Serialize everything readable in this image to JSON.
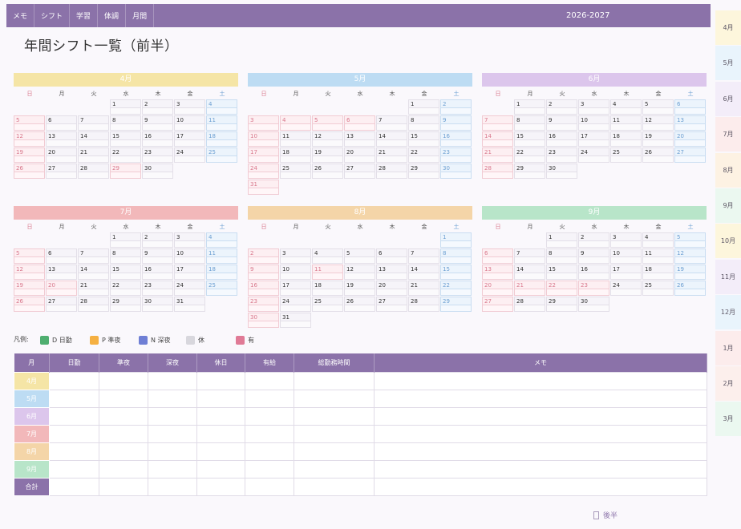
{
  "colors": {
    "accent": "#8b72a9"
  },
  "nav": {
    "tabs": [
      {
        "label": "メモ"
      },
      {
        "label": "シフト"
      },
      {
        "label": "学習"
      },
      {
        "label": "体調"
      },
      {
        "label": "月間"
      }
    ],
    "year_range": "2026-2027"
  },
  "side_tabs": [
    {
      "label": "4月",
      "color": "#fdf6dc"
    },
    {
      "label": "5月",
      "color": "#e9f4fc"
    },
    {
      "label": "6月",
      "color": "#f3edf9"
    },
    {
      "label": "7月",
      "color": "#fcecec"
    },
    {
      "label": "8月",
      "color": "#fdf2e3"
    },
    {
      "label": "9月",
      "color": "#ebf8f0"
    },
    {
      "label": "10月",
      "color": "#fdf6dc"
    },
    {
      "label": "11月",
      "color": "#f3edf9"
    },
    {
      "label": "12月",
      "color": "#e9f4fc"
    },
    {
      "label": "1月",
      "color": "#fcecec"
    },
    {
      "label": "2月",
      "color": "#fcefec"
    },
    {
      "label": "3月",
      "color": "#ebf8f0"
    }
  ],
  "title": "年間シフト一覧（前半）",
  "weekdays": [
    "日",
    "月",
    "火",
    "水",
    "木",
    "金",
    "土"
  ],
  "calendars": [
    {
      "label": "4月",
      "color": "#f5e5a6",
      "holidays": [
        29
      ],
      "weeks": [
        [
          null,
          null,
          null,
          1,
          2,
          3,
          4
        ],
        [
          5,
          6,
          7,
          8,
          9,
          10,
          11
        ],
        [
          12,
          13,
          14,
          15,
          16,
          17,
          18
        ],
        [
          19,
          20,
          21,
          22,
          23,
          24,
          25
        ],
        [
          26,
          27,
          28,
          29,
          30,
          null,
          null
        ]
      ]
    },
    {
      "label": "5月",
      "color": "#bddcf3",
      "holidays": [
        4,
        5,
        6
      ],
      "weeks": [
        [
          null,
          null,
          null,
          null,
          null,
          1,
          2
        ],
        [
          3,
          4,
          5,
          6,
          7,
          8,
          9
        ],
        [
          10,
          11,
          12,
          13,
          14,
          15,
          16
        ],
        [
          17,
          18,
          19,
          20,
          21,
          22,
          23
        ],
        [
          24,
          25,
          26,
          27,
          28,
          29,
          30
        ],
        [
          31,
          null,
          null,
          null,
          null,
          null,
          null
        ]
      ]
    },
    {
      "label": "6月",
      "color": "#dcc6ec",
      "holidays": [],
      "weeks": [
        [
          null,
          1,
          2,
          3,
          4,
          5,
          6
        ],
        [
          7,
          8,
          9,
          10,
          11,
          12,
          13
        ],
        [
          14,
          15,
          16,
          17,
          18,
          19,
          20
        ],
        [
          21,
          22,
          23,
          24,
          25,
          26,
          27
        ],
        [
          28,
          29,
          30,
          null,
          null,
          null,
          null
        ]
      ]
    },
    {
      "label": "7月",
      "color": "#f2b8ba",
      "holidays": [
        20
      ],
      "weeks": [
        [
          null,
          null,
          null,
          1,
          2,
          3,
          4
        ],
        [
          5,
          6,
          7,
          8,
          9,
          10,
          11
        ],
        [
          12,
          13,
          14,
          15,
          16,
          17,
          18
        ],
        [
          19,
          20,
          21,
          22,
          23,
          24,
          25
        ],
        [
          26,
          27,
          28,
          29,
          30,
          31,
          null
        ]
      ]
    },
    {
      "label": "8月",
      "color": "#f4d5a8",
      "holidays": [
        11
      ],
      "weeks": [
        [
          null,
          null,
          null,
          null,
          null,
          null,
          1
        ],
        [
          2,
          3,
          4,
          5,
          6,
          7,
          8
        ],
        [
          9,
          10,
          11,
          12,
          13,
          14,
          15
        ],
        [
          16,
          17,
          18,
          19,
          20,
          21,
          22
        ],
        [
          23,
          24,
          25,
          26,
          27,
          28,
          29
        ],
        [
          30,
          31,
          null,
          null,
          null,
          null,
          null
        ]
      ]
    },
    {
      "label": "9月",
      "color": "#b8e5c9",
      "holidays": [
        21,
        22,
        23
      ],
      "weeks": [
        [
          null,
          null,
          1,
          2,
          3,
          4,
          5
        ],
        [
          6,
          7,
          8,
          9,
          10,
          11,
          12
        ],
        [
          13,
          14,
          15,
          16,
          17,
          18,
          19
        ],
        [
          20,
          21,
          22,
          23,
          24,
          25,
          26
        ],
        [
          27,
          28,
          29,
          30,
          null,
          null,
          null
        ]
      ]
    }
  ],
  "legend": {
    "label": "凡例:",
    "items": [
      {
        "text": "D 日勤",
        "color": "#4fae70"
      },
      {
        "text": "P 準夜",
        "color": "#f5b042"
      },
      {
        "text": "N 深夜",
        "color": "#6f7fd5"
      },
      {
        "text": "休",
        "color": "#d8d7dd"
      },
      {
        "text": "有",
        "color": "#e07a96"
      }
    ]
  },
  "summary": {
    "headers": [
      "月",
      "日勤",
      "準夜",
      "深夜",
      "休日",
      "有給",
      "総勤務時間",
      "メモ"
    ],
    "rows": [
      {
        "month": "4月",
        "color": "#f5e5a6"
      },
      {
        "month": "5月",
        "color": "#bddcf3"
      },
      {
        "month": "6月",
        "color": "#dcc6ec"
      },
      {
        "month": "7月",
        "color": "#f2b8ba"
      },
      {
        "month": "8月",
        "color": "#f4d5a8"
      },
      {
        "month": "9月",
        "color": "#b8e5c9"
      },
      {
        "month": "合計",
        "color": "#8b72a9"
      }
    ]
  },
  "footer": {
    "label": "後半",
    "icon": "next-page-icon"
  }
}
